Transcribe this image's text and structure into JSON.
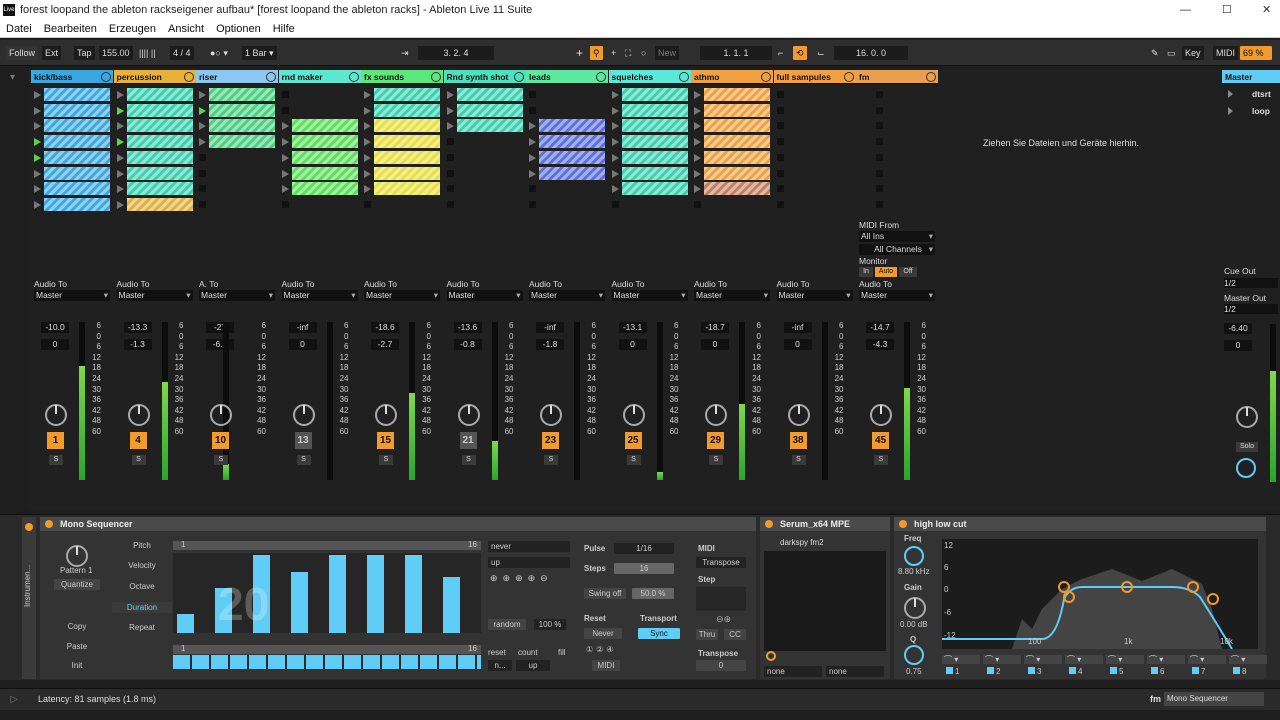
{
  "window": {
    "title": "forest loopand the ableton rackseigener aufbau*  [forest loopand the ableton racks] - Ableton Live 11 Suite",
    "logo": "Live"
  },
  "menu": [
    "Datei",
    "Bearbeiten",
    "Erzeugen",
    "Ansicht",
    "Optionen",
    "Hilfe"
  ],
  "transport": {
    "follow": "Follow",
    "ext": "Ext",
    "tap": "Tap",
    "tempo": "155.00",
    "meter_sep": "|||| ||",
    "signature": "4 / 4",
    "rec_dots": "●○ ▾",
    "quant": "1 Bar ▾",
    "position": "3.   2.   4",
    "loop_start": "1.   1.   1",
    "loop_len": "16.   0.   0",
    "key": "Key",
    "midi": "MIDI",
    "cpu": "69 %",
    "new": "New"
  },
  "tracks": [
    {
      "name": "kick/bass",
      "color": "#3aa8e0",
      "clip_colors": [
        "#3aa8e0",
        "#3aa8e0",
        "#3aa8e0",
        "#3aa8e0",
        "#3aa8e0",
        "#3aa8e0",
        "#3aa8e0",
        "#3aa8e0"
      ],
      "audio_to": "Audio To",
      "out": "Master",
      "vol": "-10.0",
      "pan": "0",
      "num": "1",
      "solo": "S"
    },
    {
      "name": "percussion",
      "color": "#e8b13a",
      "clip_colors": [
        "#3ad0b0",
        "#3ad0b0",
        "#3ad0b0",
        "#3ad0b0",
        "#3ad0b0",
        "#3ad0b0",
        "#3ad0b0",
        "#e0b040"
      ],
      "audio_to": "Audio To",
      "out": "Master",
      "vol": "-13.3",
      "pan": "-1.3",
      "num": "4",
      "solo": "S"
    },
    {
      "name": "riser",
      "color": "#8bc8f0",
      "clip_colors": [
        "#4ad080",
        "#4ad080",
        "#4ad080",
        "#4ad080"
      ],
      "audio_to": "A. To",
      "out": "Master",
      "vol": "-27",
      "pan": "-6.8",
      "num": "10",
      "solo": "S"
    },
    {
      "name": "rnd maker",
      "color": "#5ce8d0",
      "clip_colors": [
        "",
        "",
        "#5be05a",
        "#5be05a",
        "#5be05a",
        "#5be05a",
        "#5be05a"
      ],
      "audio_to": "Audio To",
      "out": "Master",
      "vol": "-inf",
      "pan": "0",
      "num": "13",
      "solo": "S"
    },
    {
      "name": "fx sounds",
      "color": "#5ce87a",
      "clip_colors": [
        "#3ad0b0",
        "#3ad0b0",
        "#e8e040",
        "#e8e040",
        "#e8e040",
        "#e8e040",
        "#e8e040"
      ],
      "audio_to": "Audio To",
      "out": "Master",
      "vol": "-18.6",
      "pan": "-2.7",
      "num": "15",
      "solo": "S"
    },
    {
      "name": "Rnd synth shot",
      "color": "#4ae0c0",
      "clip_colors": [
        "#3ad0b0",
        "#3ad0b0",
        "#3ad0b0"
      ],
      "audio_to": "Audio To",
      "out": "Master",
      "vol": "-13.6",
      "pan": "-0.8",
      "num": "21",
      "solo": "S"
    },
    {
      "name": "leads",
      "color": "#5ce8a0",
      "clip_colors": [
        "",
        "",
        "#5a70e0",
        "#5a70e0",
        "#5a70e0",
        "#5a70e0"
      ],
      "audio_to": "Audio To",
      "out": "Master",
      "vol": "-inf",
      "pan": "-1.8",
      "num": "23",
      "solo": "S"
    },
    {
      "name": "squelches",
      "color": "#5ce8d8",
      "clip_colors": [
        "#3ad0b0",
        "#3ad0b0",
        "#3ad0b0",
        "#3ad0b0",
        "#3ad0b0",
        "#3ad0b0",
        "#3ad0b0"
      ],
      "audio_to": "Audio To",
      "out": "Master",
      "vol": "-13.1",
      "pan": "0",
      "num": "25",
      "solo": "S"
    },
    {
      "name": "athmo",
      "color": "#f0a040",
      "clip_colors": [
        "#f0a040",
        "#f0a040",
        "#f0a040",
        "#f0a040",
        "#f0a040",
        "#f0a040",
        "#c08060"
      ],
      "audio_to": "Audio To",
      "out": "Master",
      "vol": "-18.7",
      "pan": "0",
      "num": "29",
      "solo": "S"
    },
    {
      "name": "full sampules",
      "color": "#f0a040",
      "clip_colors": [],
      "audio_to": "Audio To",
      "out": "Master",
      "vol": "-inf",
      "pan": "0",
      "num": "38",
      "solo": "S"
    },
    {
      "name": "fm",
      "color": "#e8a050",
      "clip_colors": [],
      "audio_to": "Audio To",
      "out": "Master",
      "vol": "-14.7",
      "pan": "-4.3",
      "num": "45",
      "solo": "S"
    }
  ],
  "scale_ticks": [
    "6",
    "0",
    "6",
    "12",
    "18",
    "24",
    "30",
    "36",
    "42",
    "48",
    "60"
  ],
  "fm_midi": {
    "midi_from": "MIDI From",
    "all_ins": "All Ins",
    "all_channels": "All Channels",
    "monitor": "Monitor",
    "in": "In",
    "auto": "Auto",
    "off": "Off"
  },
  "drop_hint": "Ziehen Sie Dateien und Geräte hierhin.",
  "master": {
    "name": "Master",
    "scenes": [
      "dtsrt",
      "loop"
    ],
    "cue_out": "Cue Out",
    "cue_val": "1/2",
    "master_out": "Master Out",
    "master_val": "1/2",
    "vol": "-6.40",
    "pan": "0",
    "solo": "Solo"
  },
  "mono_seq": {
    "title": "Mono Sequencer",
    "pattern": "Pattern 1",
    "quantize": "Quantize",
    "copy": "Copy",
    "paste": "Paste",
    "init": "Init",
    "modes": [
      "Pitch",
      "Velocity",
      "Octave",
      "Duration",
      "Repeat"
    ],
    "range_start": "1",
    "range_end": "16",
    "big_num": "20",
    "never": "never",
    "up": "up",
    "random": "random",
    "random_pct": "100 %",
    "pulse_label": "Pulse",
    "pulse": "1/16",
    "steps_label": "Steps",
    "steps": "16",
    "swing_label": "Swing off",
    "swing": "50.0 %",
    "reset": "Reset",
    "never2": "Never",
    "transport": "Transport",
    "sync": "Sync",
    "midi_btn": "MIDI",
    "midi_label": "MIDI",
    "transpose_sel": "Transpose",
    "step": "Step",
    "thru": "Thru",
    "cc": "CC",
    "transpose": "Transpose",
    "transpose_val": "0",
    "reset2": "reset",
    "count": "count",
    "fill": "fill",
    "reset_val": "n...",
    "count_val": "up",
    "side": "Instrumen...",
    "bars": [
      0.25,
      0.58,
      1.0,
      0.78,
      1.0,
      1.0,
      1.0,
      0.72
    ]
  },
  "serum": {
    "title": "Serum_x64 MPE",
    "preset": "darkspy fm2",
    "none1": "none",
    "none2": "none"
  },
  "eq": {
    "title": "high low cut",
    "freq_label": "Freq",
    "freq": "8.80 kHz",
    "gain_label": "Gain",
    "gain": "0.00 dB",
    "q_label": "Q",
    "q": "0.75",
    "db": [
      "12",
      "6",
      "0",
      "-6",
      "-12"
    ],
    "hz": [
      "100",
      "1k",
      "10k"
    ],
    "bands": [
      "1",
      "2",
      "3",
      "4",
      "5",
      "6",
      "7",
      "8"
    ]
  },
  "status": {
    "latency": "Latency: 81 samples (1.8 ms)",
    "track": "fm",
    "device": "Mono Sequencer"
  }
}
